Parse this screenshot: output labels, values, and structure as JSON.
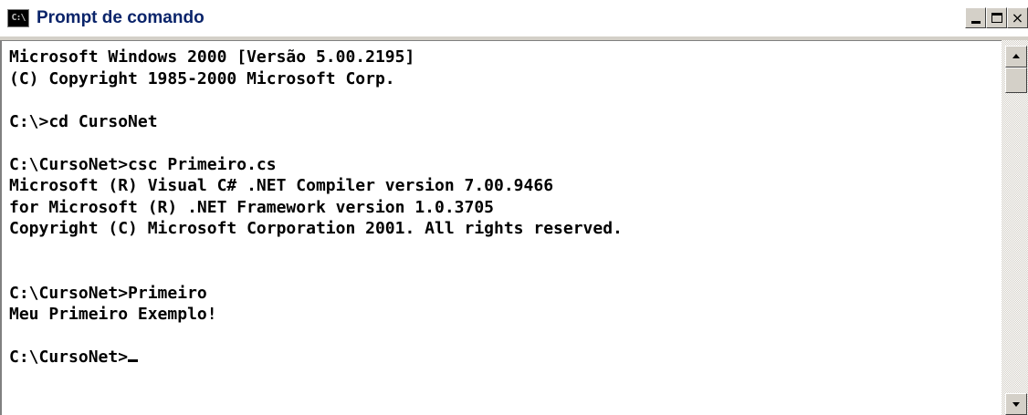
{
  "window": {
    "title": "Prompt de comando",
    "icon_text": "C:\\",
    "buttons": {
      "minimize": "minimize",
      "maximize": "maximize",
      "close": "×"
    }
  },
  "console": {
    "lines": [
      "Microsoft Windows 2000 [Versão 5.00.2195]",
      "(C) Copyright 1985-2000 Microsoft Corp.",
      "",
      "C:\\>cd CursoNet",
      "",
      "C:\\CursoNet>csc Primeiro.cs",
      "Microsoft (R) Visual C# .NET Compiler version 7.00.9466",
      "for Microsoft (R) .NET Framework version 1.0.3705",
      "Copyright (C) Microsoft Corporation 2001. All rights reserved.",
      "",
      "",
      "C:\\CursoNet>Primeiro",
      "Meu Primeiro Exemplo!",
      "",
      "C:\\CursoNet>"
    ]
  }
}
